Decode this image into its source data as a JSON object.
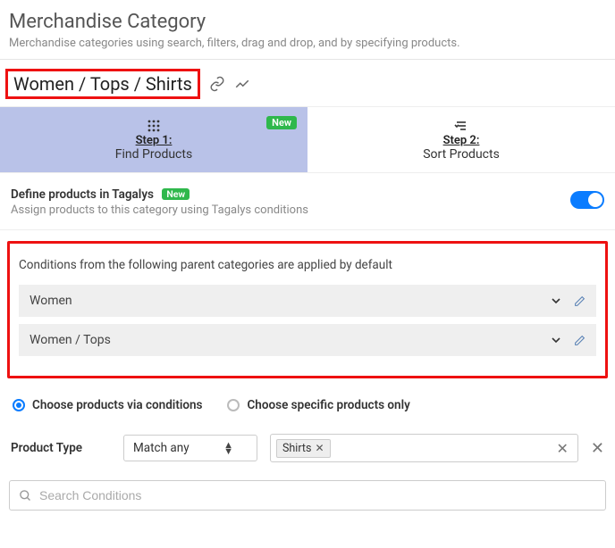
{
  "header": {
    "title": "Merchandise Category",
    "subtitle": "Merchandise categories using search, filters, drag and drop, and by specifying products."
  },
  "breadcrumb": "Women / Tops / Shirts",
  "steps": {
    "new_badge": "New",
    "step1": {
      "label": "Step 1:",
      "desc": "Find Products"
    },
    "step2": {
      "label": "Step 2:",
      "desc": "Sort Products"
    }
  },
  "define": {
    "title": "Define products in Tagalys",
    "badge": "New",
    "subtitle": "Assign products to this category using Tagalys conditions"
  },
  "parent_box": {
    "title": "Conditions from the following parent categories are applied by default",
    "items": [
      "Women",
      "Women / Tops"
    ]
  },
  "radios": {
    "opt1": "Choose products via conditions",
    "opt2": "Choose specific products only"
  },
  "filter": {
    "label": "Product Type",
    "match_mode": "Match any",
    "chip": "Shirts"
  },
  "search": {
    "placeholder": "Search Conditions"
  }
}
